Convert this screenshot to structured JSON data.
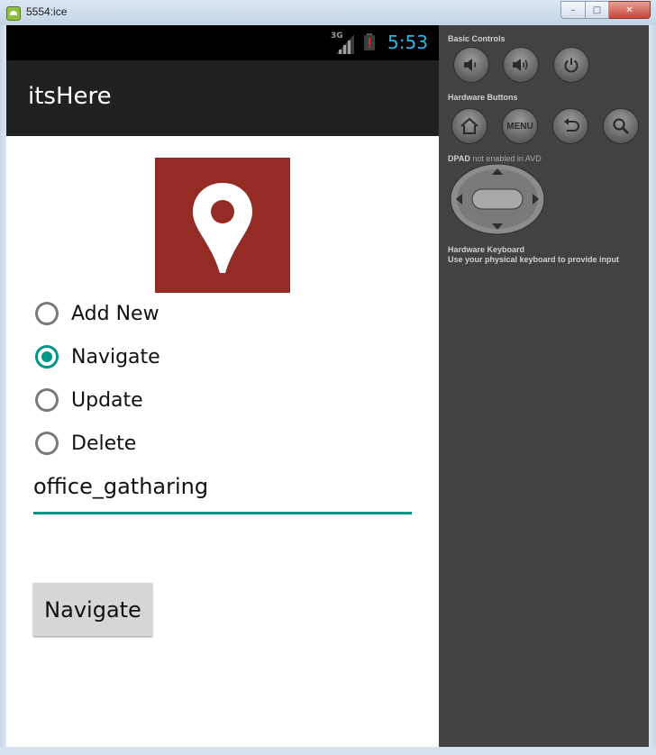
{
  "window": {
    "title": "5554:ice",
    "minimize_glyph": "–",
    "maximize_glyph": "□",
    "close_glyph": "✕"
  },
  "status_bar": {
    "network": "3G",
    "time": "5:53"
  },
  "action_bar": {
    "title": "itsHere"
  },
  "logo": {
    "icon": "location-pin-icon",
    "background": "#942b24"
  },
  "options": [
    {
      "label": "Add New",
      "checked": false
    },
    {
      "label": "Navigate",
      "checked": true
    },
    {
      "label": "Update",
      "checked": false
    },
    {
      "label": "Delete",
      "checked": false
    }
  ],
  "input": {
    "value": "office_gatharing"
  },
  "primary_button": {
    "label": "Navigate"
  },
  "emulator": {
    "basic_controls_label": "Basic Controls",
    "hardware_buttons_label": "Hardware Buttons",
    "menu_label": "MENU",
    "dpad_label": "DPAD",
    "dpad_note": "not enabled in AVD",
    "keyboard_label": "Hardware Keyboard",
    "keyboard_note": "Use your physical keyboard to provide input"
  },
  "colors": {
    "accent": "#009688",
    "clock": "#33b5e5",
    "action_bar": "#212121",
    "panel": "#424242"
  }
}
